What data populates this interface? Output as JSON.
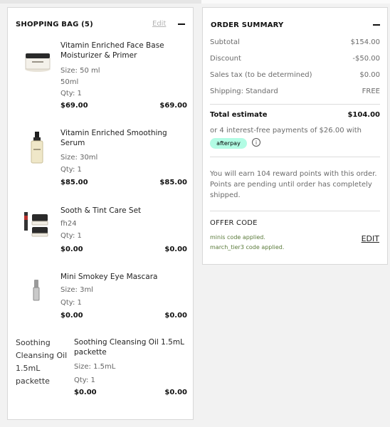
{
  "bag": {
    "title": "SHOPPING BAG (5)",
    "edit_label": "Edit",
    "items": [
      {
        "name": "Vitamin Enriched Face Base Moisturizer & Primer",
        "size": "Size: 50 ml",
        "extra": "50ml",
        "qty": "Qty: 1",
        "unit_price": "$69.00",
        "total": "$69.00"
      },
      {
        "name": "Vitamin Enriched Smoothing Serum",
        "size": "Size: 30ml",
        "qty": "Qty: 1",
        "unit_price": "$85.00",
        "total": "$85.00"
      },
      {
        "name": "Sooth & Tint Care Set",
        "extra": "fh24",
        "qty": "Qty: 1",
        "unit_price": "$0.00",
        "total": "$0.00"
      },
      {
        "name": "Mini Smokey Eye Mascara",
        "size": "Size: 3ml",
        "qty": "Qty: 1",
        "unit_price": "$0.00",
        "total": "$0.00"
      },
      {
        "image_alt": "Soothing Cleansing Oil 1.5mL packette",
        "name": "Soothing Cleansing Oil 1.5mL packette",
        "size": "Size: 1.5mL",
        "qty": "Qty: 1",
        "unit_price": "$0.00",
        "total": "$0.00"
      }
    ]
  },
  "summary": {
    "title": "ORDER SUMMARY",
    "rows": [
      {
        "label": "Subtotal",
        "value": "$154.00"
      },
      {
        "label": "Discount",
        "value": "-$50.00"
      },
      {
        "label": "Sales tax (to be determined)",
        "value": "$0.00"
      },
      {
        "label": "Shipping: Standard",
        "value": "FREE"
      }
    ],
    "total_label": "Total estimate",
    "total_value": "$104.00",
    "installments_text": "or 4 interest-free payments of $26.00 with",
    "afterpay_label": "afterpay",
    "info_glyph": "i",
    "rewards_text": "You will earn 104 reward points with this order. Points are pending until order has completely shipped.",
    "offer_title": "OFFER CODE",
    "offer_applied": [
      "minis code applied.",
      "march_tier3 code applied."
    ],
    "offer_edit": "EDIT"
  },
  "colors": {
    "afterpay": "#b2fce4",
    "offer_green": "#5a7a3a"
  }
}
